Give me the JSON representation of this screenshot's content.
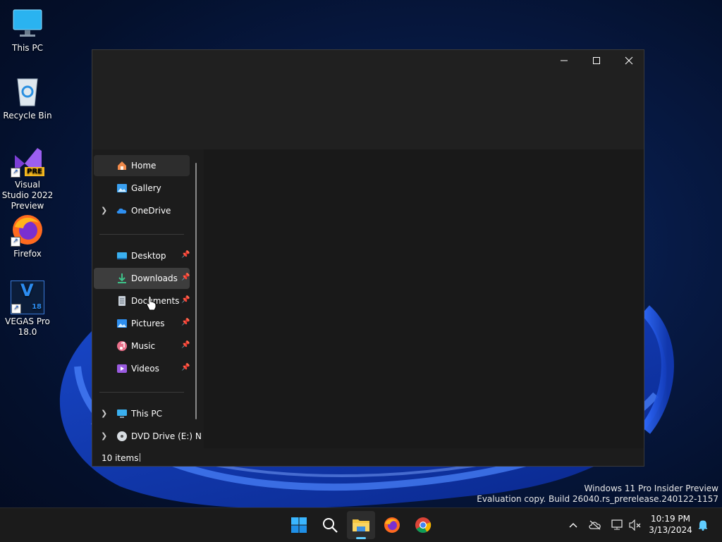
{
  "desktop": {
    "icons": [
      {
        "label": "This PC"
      },
      {
        "label": "Recycle Bin"
      },
      {
        "label": "Visual Studio 2022 Preview",
        "badge": "PRE"
      },
      {
        "label": "Firefox"
      },
      {
        "label": "VEGAS Pro 18.0",
        "glyph": "V",
        "badge": "18"
      }
    ]
  },
  "window": {
    "nav": {
      "home": "Home",
      "gallery": "Gallery",
      "onedrive": "OneDrive",
      "desktop": "Desktop",
      "downloads": "Downloads",
      "documents": "Documents",
      "pictures": "Pictures",
      "music": "Music",
      "videos": "Videos",
      "thispc": "This PC",
      "dvd": "DVD Drive (E:) N"
    },
    "status": {
      "items": "10 items"
    }
  },
  "watermark": {
    "line1": "Windows 11 Pro Insider Preview",
    "line2": "Evaluation copy. Build 26040.rs_prerelease.240122-1157"
  },
  "clock": {
    "time": "10:19 PM",
    "date": "3/13/2024"
  },
  "colors": {
    "accent": "#0078d4",
    "taskbar": "#1b1b1b",
    "window": "#1c1c1c"
  }
}
